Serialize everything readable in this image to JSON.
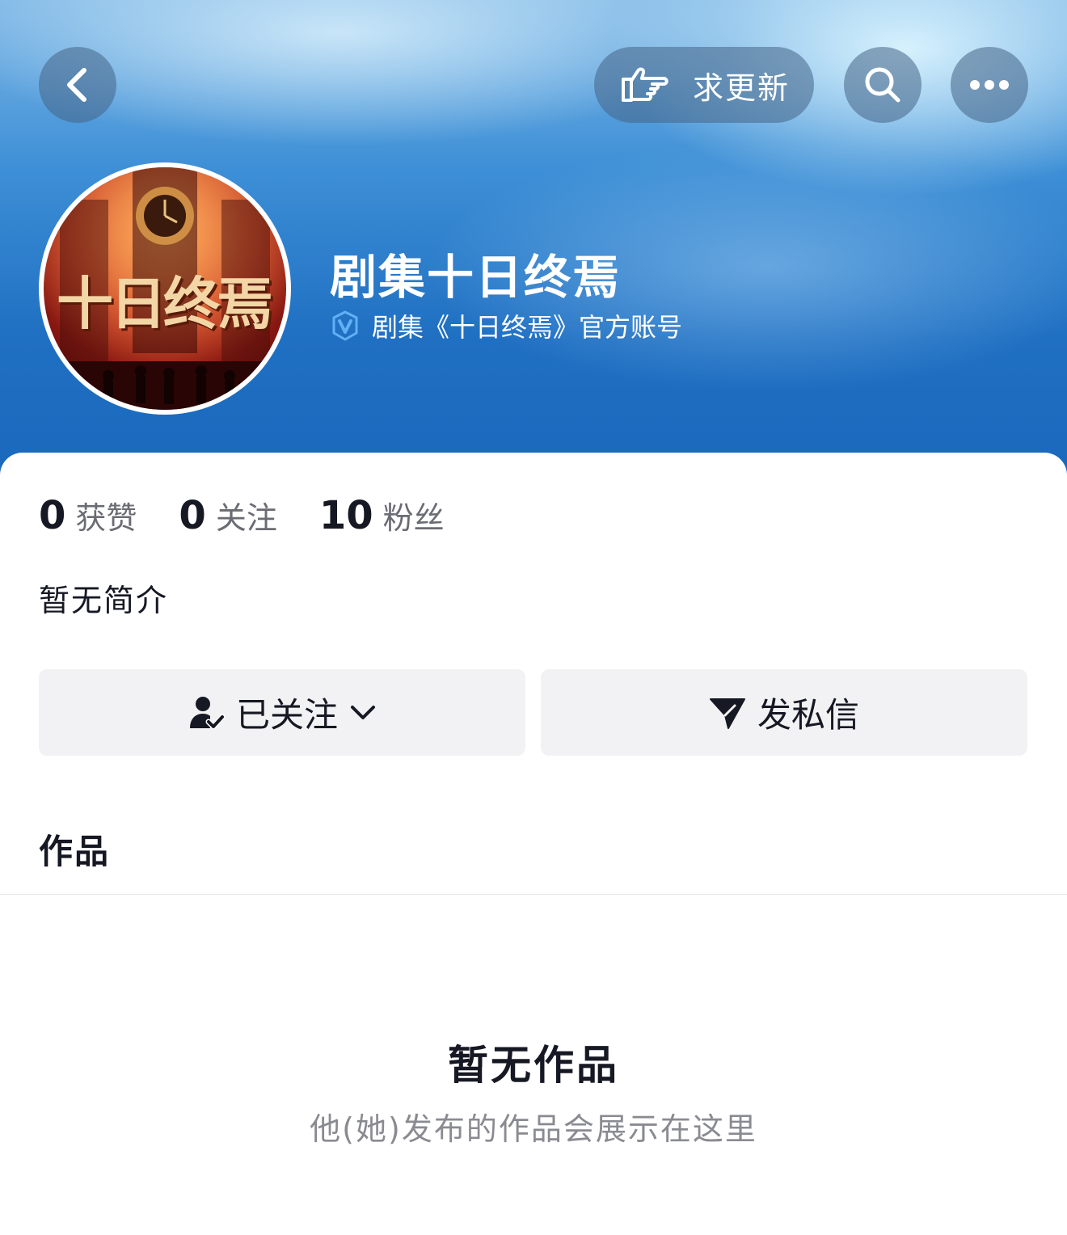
{
  "header": {
    "request_update_label": "求更新"
  },
  "profile": {
    "name": "剧集十日终焉",
    "verification": "剧集《十日终焉》官方账号",
    "avatar_text": "十日终焉"
  },
  "stats": [
    {
      "value": "0",
      "label": "获赞"
    },
    {
      "value": "0",
      "label": "关注"
    },
    {
      "value": "10",
      "label": "粉丝"
    }
  ],
  "bio": "暂无简介",
  "actions": {
    "follow_label": "已关注",
    "message_label": "发私信"
  },
  "works": {
    "title": "作品",
    "empty_title": "暂无作品",
    "empty_subtitle": "他(她)发布的作品会展示在这里"
  },
  "colors": {
    "header_blue": "#1f6fc2",
    "verify_badge": "#5fb0f5",
    "button_bg": "#f2f2f4",
    "text_primary": "#161823",
    "text_secondary": "#8a8b91"
  }
}
